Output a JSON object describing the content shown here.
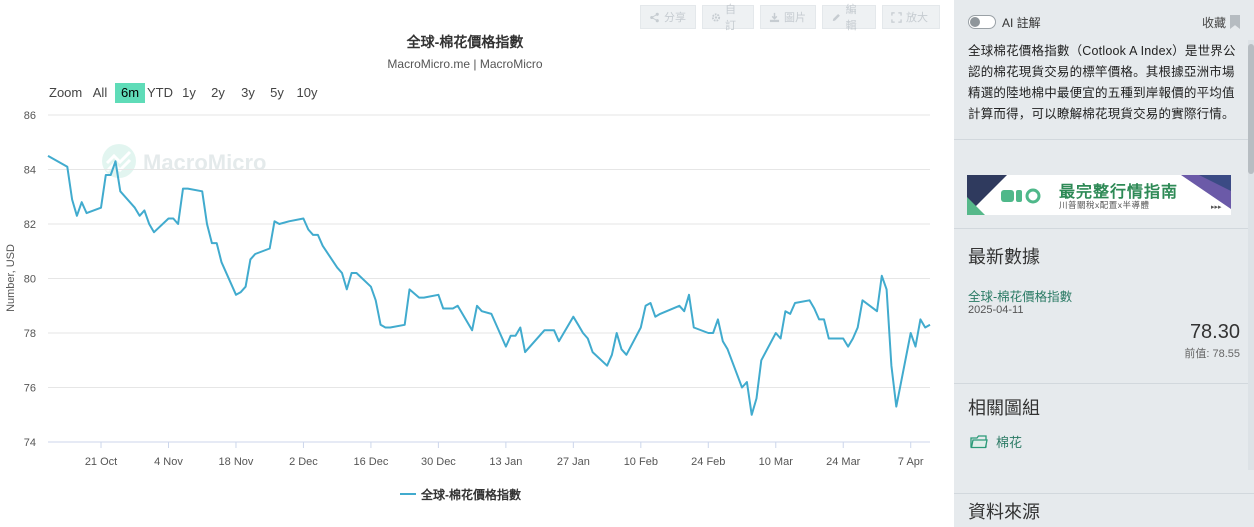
{
  "toolbar": {
    "share": "分享",
    "settings": "自訂",
    "image": "圖片",
    "edit": "編輯",
    "enlarge": "放大"
  },
  "zoom": {
    "label": "Zoom",
    "options": [
      "All",
      "6m",
      "YTD",
      "1y",
      "2y",
      "3y",
      "5y",
      "10y"
    ],
    "active": "6m"
  },
  "watermark": "MacroMicro",
  "colors": {
    "series": "#41abce",
    "zoom_active": "#5fdcb8",
    "accent": "#2a7a64"
  },
  "chart_data": {
    "type": "line",
    "title": "全球-棉花價格指數",
    "subtitle": "MacroMicro.me | MacroMicro",
    "ylabel": "Number, USD",
    "xlabel": "",
    "ylim": [
      74,
      86
    ],
    "yticks": [
      74,
      76,
      78,
      80,
      82,
      84,
      86
    ],
    "xlim": [
      "2024-10-10",
      "2025-04-11"
    ],
    "xticks": [
      {
        "date": "2024-10-21",
        "label": "21 Oct"
      },
      {
        "date": "2024-11-04",
        "label": "4 Nov"
      },
      {
        "date": "2024-11-18",
        "label": "18 Nov"
      },
      {
        "date": "2024-12-02",
        "label": "2 Dec"
      },
      {
        "date": "2024-12-16",
        "label": "16 Dec"
      },
      {
        "date": "2024-12-30",
        "label": "30 Dec"
      },
      {
        "date": "2025-01-13",
        "label": "13 Jan"
      },
      {
        "date": "2025-01-27",
        "label": "27 Jan"
      },
      {
        "date": "2025-02-10",
        "label": "10 Feb"
      },
      {
        "date": "2025-02-24",
        "label": "24 Feb"
      },
      {
        "date": "2025-03-10",
        "label": "10 Mar"
      },
      {
        "date": "2025-03-24",
        "label": "24 Mar"
      },
      {
        "date": "2025-04-07",
        "label": "7 Apr"
      }
    ],
    "grid": true,
    "legend": "bottom-center",
    "series": [
      {
        "name": "全球-棉花價格指數",
        "x": [
          "2024-10-10",
          "2024-10-14",
          "2024-10-15",
          "2024-10-16",
          "2024-10-17",
          "2024-10-18",
          "2024-10-21",
          "2024-10-22",
          "2024-10-23",
          "2024-10-24",
          "2024-10-25",
          "2024-10-28",
          "2024-10-29",
          "2024-10-30",
          "2024-10-31",
          "2024-11-01",
          "2024-11-04",
          "2024-11-05",
          "2024-11-06",
          "2024-11-07",
          "2024-11-08",
          "2024-11-11",
          "2024-11-12",
          "2024-11-13",
          "2024-11-14",
          "2024-11-15",
          "2024-11-18",
          "2024-11-19",
          "2024-11-20",
          "2024-11-21",
          "2024-11-22",
          "2024-11-25",
          "2024-11-26",
          "2024-11-27",
          "2024-11-29",
          "2024-12-02",
          "2024-12-03",
          "2024-12-04",
          "2024-12-05",
          "2024-12-06",
          "2024-12-09",
          "2024-12-10",
          "2024-12-11",
          "2024-12-12",
          "2024-12-13",
          "2024-12-16",
          "2024-12-17",
          "2024-12-18",
          "2024-12-19",
          "2024-12-20",
          "2024-12-23",
          "2024-12-24",
          "2024-12-26",
          "2024-12-27",
          "2024-12-30",
          "2024-12-31",
          "2025-01-02",
          "2025-01-03",
          "2025-01-06",
          "2025-01-07",
          "2025-01-08",
          "2025-01-10",
          "2025-01-13",
          "2025-01-14",
          "2025-01-15",
          "2025-01-16",
          "2025-01-17",
          "2025-01-21",
          "2025-01-22",
          "2025-01-23",
          "2025-01-24",
          "2025-01-27",
          "2025-01-28",
          "2025-01-29",
          "2025-01-30",
          "2025-01-31",
          "2025-02-03",
          "2025-02-04",
          "2025-02-05",
          "2025-02-06",
          "2025-02-07",
          "2025-02-10",
          "2025-02-11",
          "2025-02-12",
          "2025-02-13",
          "2025-02-14",
          "2025-02-18",
          "2025-02-19",
          "2025-02-20",
          "2025-02-21",
          "2025-02-24",
          "2025-02-25",
          "2025-02-26",
          "2025-02-27",
          "2025-02-28",
          "2025-03-03",
          "2025-03-04",
          "2025-03-05",
          "2025-03-06",
          "2025-03-07",
          "2025-03-10",
          "2025-03-11",
          "2025-03-12",
          "2025-03-13",
          "2025-03-14",
          "2025-03-17",
          "2025-03-18",
          "2025-03-19",
          "2025-03-20",
          "2025-03-21",
          "2025-03-24",
          "2025-03-25",
          "2025-03-26",
          "2025-03-27",
          "2025-03-28",
          "2025-03-31",
          "2025-04-01",
          "2025-04-02",
          "2025-04-03",
          "2025-04-04",
          "2025-04-07",
          "2025-04-08",
          "2025-04-09",
          "2025-04-10",
          "2025-04-11"
        ],
        "y": [
          84.5,
          84.1,
          82.9,
          82.3,
          82.8,
          82.4,
          82.6,
          83.8,
          83.8,
          84.3,
          83.2,
          82.6,
          82.3,
          82.5,
          82.0,
          81.7,
          82.2,
          82.2,
          82.0,
          83.3,
          83.3,
          83.2,
          82.0,
          81.3,
          81.3,
          80.6,
          79.4,
          79.5,
          79.7,
          80.7,
          80.9,
          81.1,
          82.1,
          82.0,
          82.1,
          82.2,
          81.8,
          81.6,
          81.6,
          81.2,
          80.4,
          80.2,
          79.6,
          80.2,
          80.2,
          79.7,
          79.2,
          78.3,
          78.2,
          78.2,
          78.3,
          79.6,
          79.3,
          79.3,
          79.4,
          78.9,
          78.9,
          79.0,
          78.1,
          79.0,
          78.8,
          78.7,
          77.5,
          77.9,
          77.9,
          78.2,
          77.3,
          78.1,
          78.1,
          78.1,
          77.7,
          78.6,
          78.3,
          78.0,
          77.8,
          77.3,
          76.8,
          77.2,
          78.0,
          77.4,
          77.2,
          78.2,
          79.0,
          79.1,
          78.6,
          78.7,
          79.0,
          78.8,
          79.4,
          78.2,
          78.0,
          78.0,
          78.5,
          77.7,
          77.4,
          76.0,
          76.2,
          75.0,
          75.6,
          77.0,
          78.0,
          77.8,
          78.8,
          78.7,
          79.1,
          79.2,
          78.9,
          78.5,
          78.5,
          77.8,
          77.8,
          77.5,
          77.8,
          78.2,
          79.2,
          78.8,
          80.1,
          79.6,
          76.8,
          75.3,
          78.0,
          77.5,
          78.5,
          78.2,
          78.3
        ]
      }
    ]
  },
  "sidebar": {
    "ai_label": "AI 註解",
    "favorite": "收藏",
    "description": "全球棉花價格指數（Cotlook A Index）是世界公認的棉花現貨交易的標竿價格。其根據亞洲市場精選的陸地棉中最便宜的五種到岸報價的平均值計算而得，可以瞭解棉花現貨交易的實際行情。",
    "banner_title": "最完整行情指南",
    "banner_sub": "川普關稅x配置x半導體",
    "latest": {
      "heading": "最新數據",
      "name": "全球-棉花價格指數",
      "date": "2025-04-11",
      "value": "78.30",
      "prev_label": "前值:",
      "prev_value": "78.55"
    },
    "related": {
      "heading": "相關圖組",
      "item": "棉花"
    },
    "source": {
      "heading": "資料來源"
    }
  }
}
